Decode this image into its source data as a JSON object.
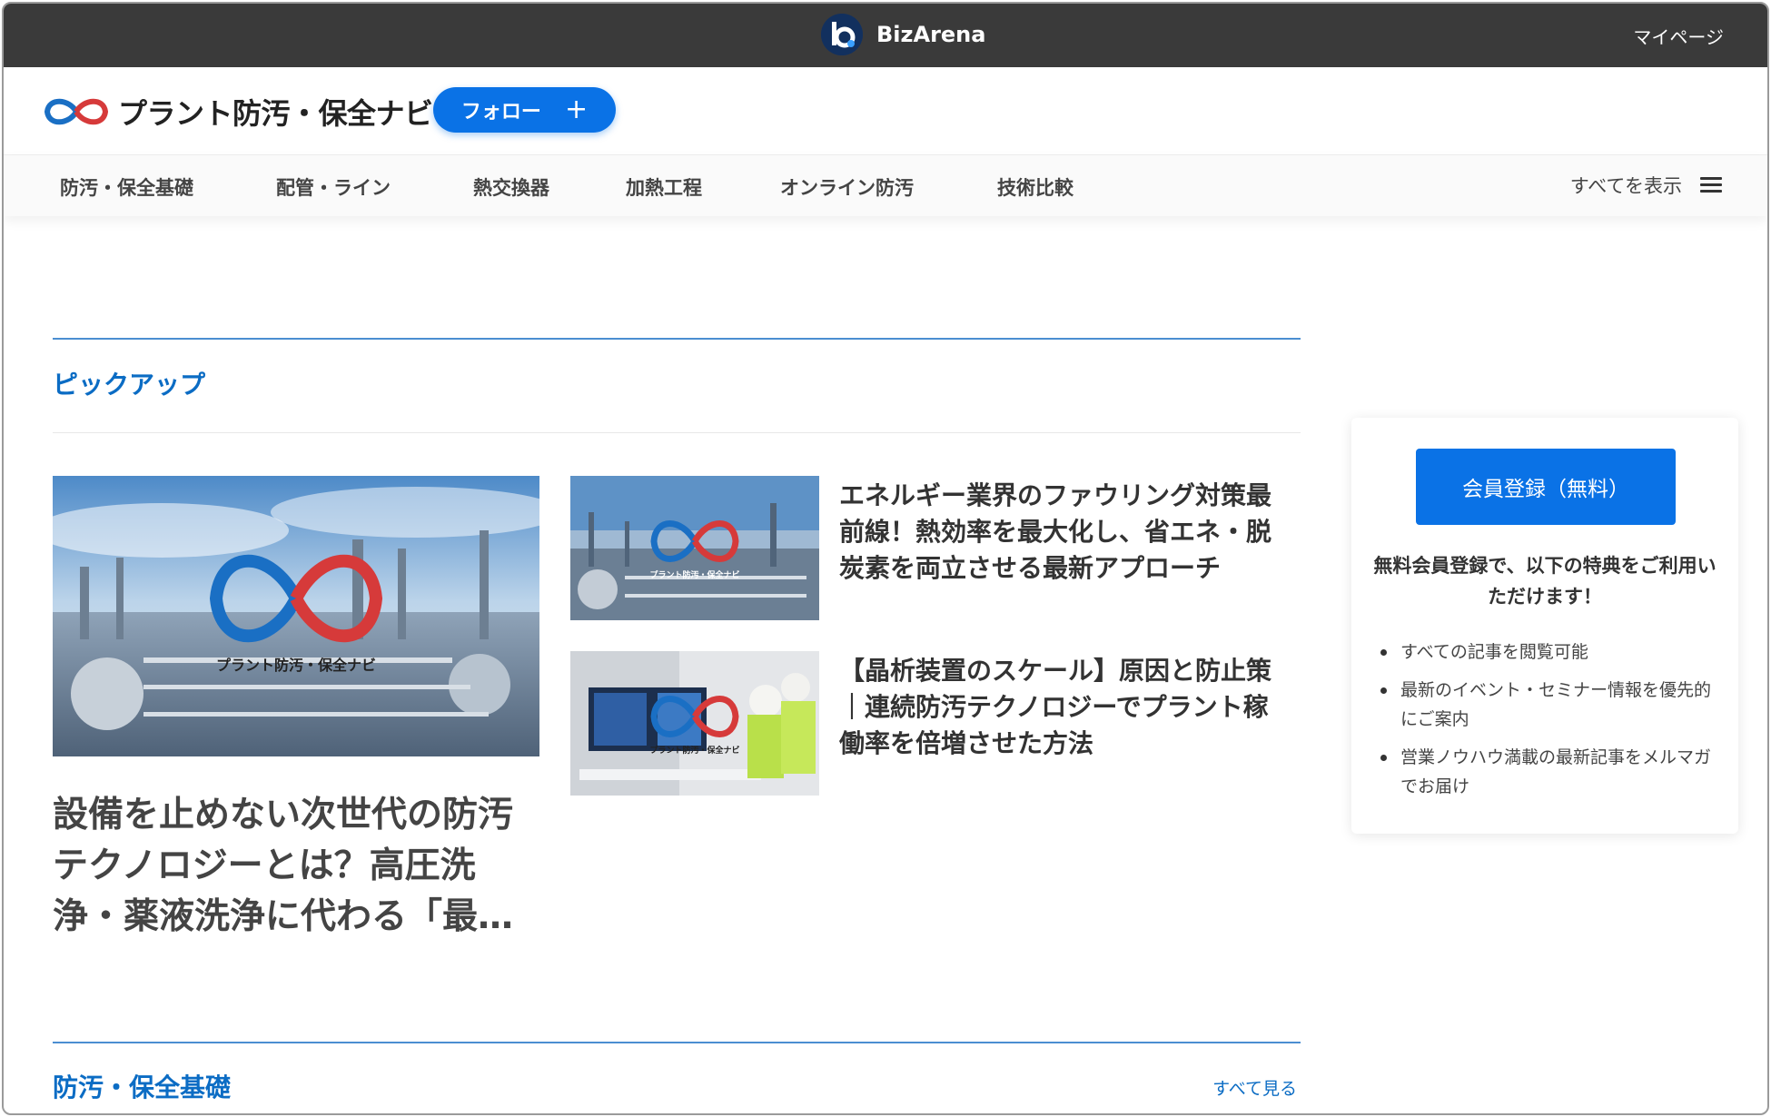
{
  "topbar": {
    "brand_name": "BizArena",
    "mypage_label": "マイページ"
  },
  "header": {
    "site_title": "プラント防汚・保全ナビ",
    "follow_label": "フォロー"
  },
  "nav": {
    "items": [
      "防汚・保全基礎",
      "配管・ライン",
      "熱交換器",
      "加熱工程",
      "オンライン防汚",
      "技術比較"
    ],
    "show_all_label": "すべてを表示"
  },
  "pickup": {
    "section_title": "ピックアップ",
    "main_article": {
      "image_caption": "プラント防汚・保全ナビ",
      "headline": "設備を止めない次世代の防汚テクノロジーとは？高圧洗浄・薬液洗浄に代わる「最…"
    },
    "side_articles": [
      {
        "image_caption": "プラント防汚・保全ナビ",
        "title": "エネルギー業界のファウリング対策最前線！熱効率を最大化し、省エネ・脱炭素を両立させる最新アプローチ"
      },
      {
        "image_caption": "プラント防汚・保全ナビ",
        "title": "【晶析装置のスケール】原因と防止策｜連続防汚テクノロジーでプラント稼働率を倍増させた方法"
      }
    ]
  },
  "category_section": {
    "title": "防汚・保全基礎",
    "see_all_label": "すべて見る"
  },
  "sidebar": {
    "register_label": "会員登録（無料）",
    "lead_text": "無料会員登録で、以下の特典をご利用いただけます！",
    "benefits": [
      "すべての記事を閲覧可能",
      "最新のイベント・セミナー情報を優先的にご案内",
      "営業ノウハウ満載の最新記事をメルマガでお届け"
    ]
  },
  "colors": {
    "accent_blue": "#0a72e6",
    "section_blue": "#0b6cc4",
    "topbar_dark": "#3a3a3a"
  }
}
